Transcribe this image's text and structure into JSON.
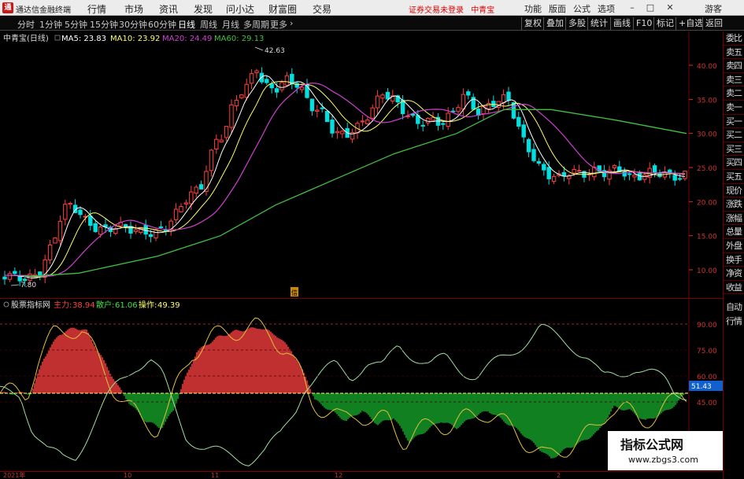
{
  "menubar": {
    "logo_text": "通",
    "app_title": "通达信金融终端",
    "menus": [
      "行情",
      "市场",
      "资讯",
      "发现",
      "问小达",
      "财富圈",
      "交易"
    ],
    "notice": "证券交易未登录",
    "stock_name": "中青宝",
    "right_items": [
      "功能",
      "版面",
      "公式",
      "选项"
    ],
    "guest": "游客"
  },
  "toolbar": {
    "periods": [
      "分时",
      "1分钟",
      "5分钟",
      "15分钟",
      "30分钟",
      "60分钟",
      "日线",
      "周线",
      "月线",
      "多周期",
      "更多"
    ],
    "active_period": "日线",
    "tools": [
      "复权",
      "叠加",
      "多股",
      "统计",
      "画线",
      "F10",
      "标记",
      "+自选",
      "返回"
    ]
  },
  "main_legend": {
    "title": "中青宝(日线)",
    "ma5": "MA5: 23.83",
    "ma10": "MA10: 23.92",
    "ma20": "MA20: 24.49",
    "ma60": "MA60: 29.13"
  },
  "main_annotations": {
    "high_label": "42.63",
    "low_label": "7.80",
    "event_marker": "信"
  },
  "price_axis": [
    "40.00",
    "35.00",
    "30.00",
    "25.00",
    "20.00",
    "15.00",
    "10.00"
  ],
  "indicator_legend": {
    "name": "股票指标网",
    "main_label": "主力:",
    "main_value": "38.94",
    "retail_label": "散户:",
    "retail_value": "61.06",
    "op_label": "操作:",
    "op_value": "49.39"
  },
  "indicator_axis": [
    "90.00",
    "75.00",
    "60.00",
    "45.00"
  ],
  "indicator_current": "51.43",
  "side_panel": [
    "委比",
    "卖五",
    "卖四",
    "卖三",
    "卖二",
    "卖一",
    "买一",
    "买二",
    "买三",
    "买四",
    "买五",
    "现价",
    "涨跌",
    "涨幅",
    "总量",
    "外盘",
    "换手",
    "净资",
    "收益"
  ],
  "side_panel_ind": [
    "自动",
    "行情"
  ],
  "date_axis": [
    "2021年",
    "10",
    "11",
    "12",
    "2"
  ],
  "watermark": {
    "line1": "指标公式网",
    "line2": "www.zbgs3.com"
  },
  "colors": {
    "up": "#ff4040",
    "down": "#00e0e0",
    "ma5": "#ffffff",
    "ma10": "#ffff66",
    "ma20": "#d040d0",
    "ma60": "#40c040",
    "red_fill": "#c03030",
    "green_fill": "#108020"
  }
}
